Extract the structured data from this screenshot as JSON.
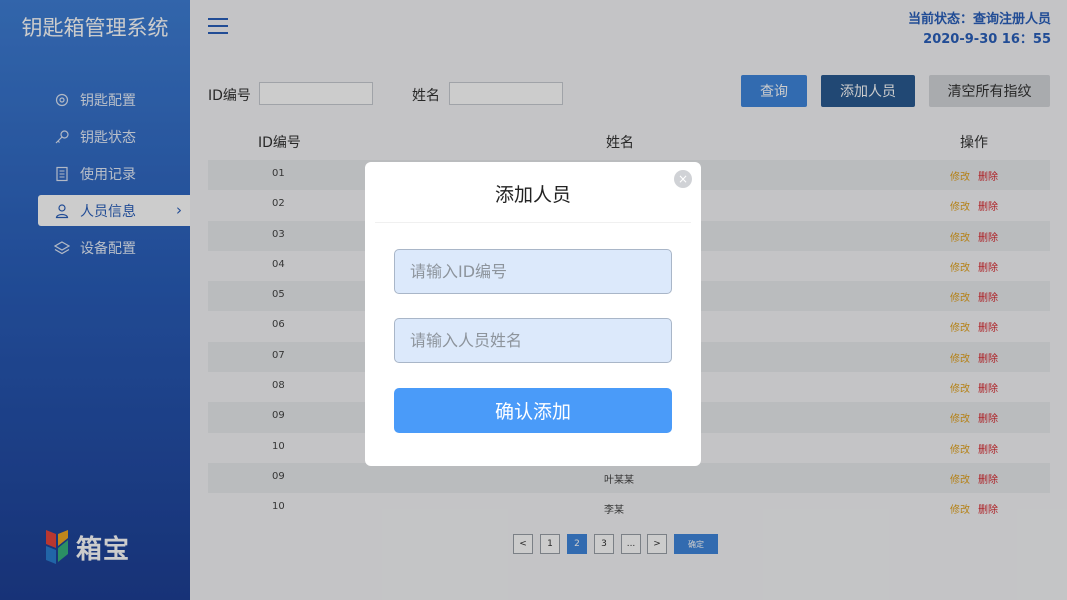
{
  "app": {
    "title": "钥匙箱管理系统",
    "logo_text": "箱宝"
  },
  "sidebar": {
    "items": [
      {
        "label": "钥匙配置",
        "icon": "gear-icon"
      },
      {
        "label": "钥匙状态",
        "icon": "key-icon"
      },
      {
        "label": "使用记录",
        "icon": "document-icon"
      },
      {
        "label": "人员信息",
        "icon": "user-icon",
        "active": true
      },
      {
        "label": "设备配置",
        "icon": "layers-icon"
      }
    ]
  },
  "header": {
    "status": "当前状态：查询注册人员",
    "datetime": "2020-9-30 16：55"
  },
  "search": {
    "id_label": "ID编号",
    "name_label": "姓名",
    "id_value": "",
    "name_value": ""
  },
  "toolbar": {
    "query": "查询",
    "add": "添加人员",
    "clear": "清空所有指纹"
  },
  "colors": {
    "query_btn": "#3f86dd",
    "add_btn": "#2a5b92",
    "clear_btn": "#d4d6da",
    "edit": "#e3a21c",
    "delete": "#d9262c"
  },
  "table": {
    "headers": [
      "ID编号",
      "姓名",
      "操作"
    ],
    "rows": [
      {
        "id": "01",
        "name": ""
      },
      {
        "id": "02",
        "name": ""
      },
      {
        "id": "03",
        "name": ""
      },
      {
        "id": "04",
        "name": ""
      },
      {
        "id": "05",
        "name": ""
      },
      {
        "id": "06",
        "name": ""
      },
      {
        "id": "07",
        "name": ""
      },
      {
        "id": "08",
        "name": ""
      },
      {
        "id": "09",
        "name": ""
      },
      {
        "id": "10",
        "name": ""
      },
      {
        "id": "09",
        "name": "叶某某"
      },
      {
        "id": "10",
        "name": "李某"
      }
    ],
    "edit_label": "修改",
    "delete_label": "删除"
  },
  "pagination": {
    "prev": "<",
    "pages": [
      "1",
      "2",
      "3"
    ],
    "current": "2",
    "ellipsis": "...",
    "next": ">",
    "confirm": "确定"
  },
  "modal": {
    "title": "添加人员",
    "id_placeholder": "请输入ID编号",
    "name_placeholder": "请输入人员姓名",
    "submit": "确认添加"
  }
}
